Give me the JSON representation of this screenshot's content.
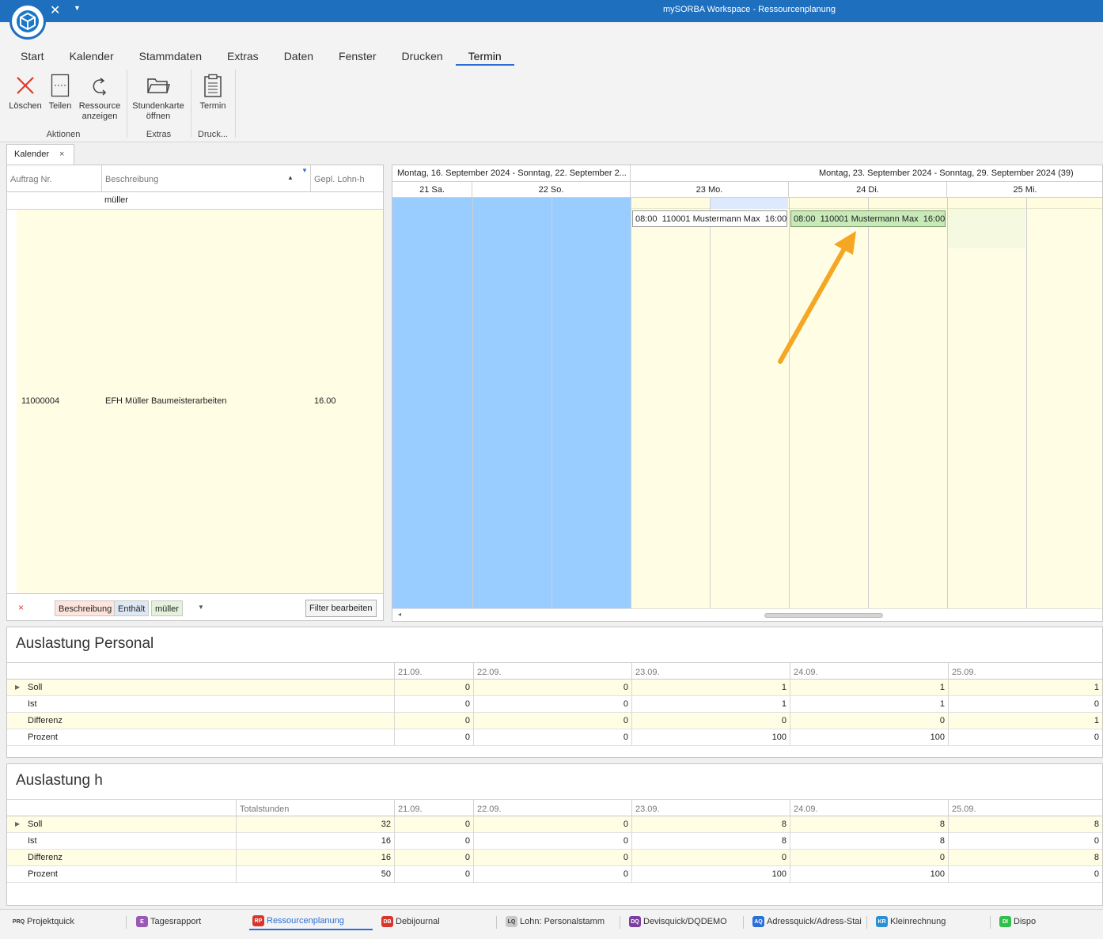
{
  "window": {
    "title": "mySORBA Workspace - Ressourcenplanung"
  },
  "ribbon": {
    "tabs": [
      "Start",
      "Kalender",
      "Stammdaten",
      "Extras",
      "Daten",
      "Fenster",
      "Drucken",
      "Termin"
    ],
    "active_tab": "Termin",
    "buttons": {
      "delete": "Löschen",
      "split": "Teilen",
      "resource_1": "Ressource",
      "resource_2": "anzeigen",
      "timecard_1": "Stundenkarte",
      "timecard_2": "öffnen",
      "appointment": "Termin"
    },
    "groups": {
      "actions": "Aktionen",
      "extras": "Extras",
      "print": "Druck..."
    }
  },
  "doc_tab": {
    "label": "Kalender",
    "close": "×"
  },
  "left_grid": {
    "columns": [
      "Auftrag Nr.",
      "Beschreibung",
      "Gepl. Lohn-h"
    ],
    "filter_value": "müller",
    "row": {
      "order_no": "11000004",
      "description": "EFH Müller Baumeisterarbeiten",
      "planned_hours": "16.00"
    },
    "filter_bar": {
      "clear": "×",
      "field": "Beschreibung",
      "operator": "Enthält",
      "value": "müller",
      "edit_button": "Filter bearbeiten"
    }
  },
  "scheduler": {
    "weeks": [
      "Montag, 16. September 2024 - Sonntag, 22. September 2...",
      "Montag, 23. September 2024 - Sonntag, 29. September 2024 (39)"
    ],
    "days": [
      "21 Sa.",
      "22 So.",
      "23 Mo.",
      "24 Di.",
      "25 Mi."
    ],
    "appointments": [
      {
        "start": "08:00",
        "text": "110001 Mustermann Max",
        "end": "16:00",
        "day": "23 Mo."
      },
      {
        "start": "08:00",
        "text": "110001 Mustermann Max",
        "end": "16:00",
        "day": "24 Di.",
        "selected": true
      }
    ],
    "colors": {
      "weekend": "#99ccff",
      "workday": "#fffde4",
      "selected_appt": "#c7eab8",
      "arrow": "#f5a623"
    }
  },
  "auslastung_personal": {
    "title": "Auslastung Personal",
    "columns": [
      "21.09.",
      "22.09.",
      "23.09.",
      "24.09.",
      "25.09."
    ],
    "rows": [
      {
        "label": "Soll",
        "values": [
          "0",
          "0",
          "1",
          "1",
          "1"
        ]
      },
      {
        "label": "Ist",
        "values": [
          "0",
          "0",
          "1",
          "1",
          "0"
        ]
      },
      {
        "label": "Differenz",
        "values": [
          "0",
          "0",
          "0",
          "0",
          "1"
        ]
      },
      {
        "label": "Prozent",
        "values": [
          "0",
          "0",
          "100",
          "100",
          "0"
        ]
      }
    ]
  },
  "auslastung_h": {
    "title": "Auslastung h",
    "columns": [
      "Totalstunden",
      "21.09.",
      "22.09.",
      "23.09.",
      "24.09.",
      "25.09."
    ],
    "rows": [
      {
        "label": "Soll",
        "values": [
          "32",
          "0",
          "0",
          "8",
          "8",
          "8"
        ]
      },
      {
        "label": "Ist",
        "values": [
          "16",
          "0",
          "0",
          "8",
          "8",
          "0"
        ]
      },
      {
        "label": "Differenz",
        "values": [
          "16",
          "0",
          "0",
          "0",
          "0",
          "8"
        ]
      },
      {
        "label": "Prozent",
        "values": [
          "50",
          "0",
          "0",
          "100",
          "100",
          "0"
        ]
      }
    ]
  },
  "taskbar": [
    {
      "abbr": "PRQ",
      "label": "Projektquick",
      "color": "#f3f3f3"
    },
    {
      "abbr": "E",
      "label": "Tagesrapport",
      "color": "#9b59b6"
    },
    {
      "abbr": "RP",
      "label": "Ressourcenplanung",
      "color": "#d9362b",
      "active": true
    },
    {
      "abbr": "DB",
      "label": "Debijournal",
      "color": "#d9362b"
    },
    {
      "abbr": "LQ",
      "label": "Lohn: Personalstamm",
      "color": "#b0b0b0"
    },
    {
      "abbr": "DQ",
      "label": "Devisquick/DQDEMO",
      "color": "#7b3fa0"
    },
    {
      "abbr": "AQ",
      "label": "Adressquick/Adress-Stai",
      "color": "#2b6fd6"
    },
    {
      "abbr": "KR",
      "label": "Kleinrechnung",
      "color": "#2b8fd6"
    },
    {
      "abbr": "DI",
      "label": "Dispo",
      "color": "#2fbf4a"
    }
  ]
}
